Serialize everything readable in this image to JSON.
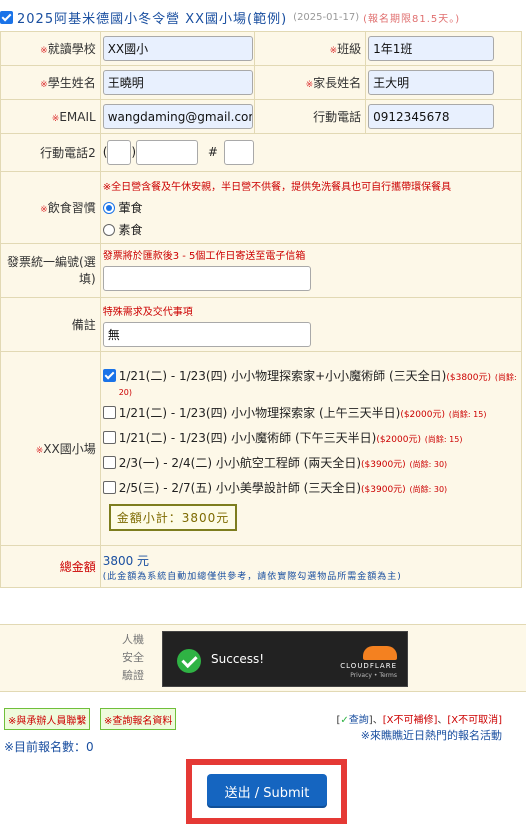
{
  "header": {
    "title": "2025阿基米德國小冬令營 XX國小場(範例)",
    "date": "(2025-01-17)",
    "deadline": "(報名期限81.5天。)"
  },
  "form": {
    "school": {
      "label": "就讀學校",
      "value": "XX國小"
    },
    "class": {
      "label": "班級",
      "value": "1年1班"
    },
    "student": {
      "label": "學生姓名",
      "value": "王曉明"
    },
    "parent": {
      "label": "家長姓名",
      "value": "王大明"
    },
    "email": {
      "label": "EMAIL",
      "value": "wangdaming@gmail.com"
    },
    "mobile": {
      "label": "行動電話",
      "value": "0912345678"
    },
    "mobile2": {
      "label": "行動電話2",
      "open_paren": "(",
      "close_paren": ")",
      "hash": "#"
    },
    "diet": {
      "label": "飲食習慣",
      "note": "※全日營含餐及午休安親，半日營不供餐，提供免洗餐具也可自行攜帶環保餐具",
      "options": [
        "葷食",
        "素食"
      ],
      "selected": "葷食"
    },
    "invoice": {
      "label": "發票統一編號(選填)",
      "note": "發票將於匯款後3 - 5個工作日寄送至電子信箱",
      "value": ""
    },
    "remark": {
      "label": "備註",
      "note": "特殊需求及交代事項",
      "value": "無"
    },
    "session": {
      "label": "XX國小場",
      "items": [
        {
          "checked": true,
          "dates": "1/21(二) - 1/23(四)",
          "course": "小小物理探索家+小小魔術師 (三天全日)",
          "price": "($3800元)",
          "remain": "(尚餘: 20)"
        },
        {
          "checked": false,
          "dates": "1/21(二) - 1/23(四)",
          "course": "小小物理探索家 (上午三天半日)",
          "price": "($2000元)",
          "remain": "(尚餘: 15)"
        },
        {
          "checked": false,
          "dates": "1/21(二) - 1/23(四)",
          "course": "小小魔術師 (下午三天半日)",
          "price": "($2000元)",
          "remain": "(尚餘: 15)"
        },
        {
          "checked": false,
          "dates": "2/3(一) - 2/4(二)",
          "course": "小小航空工程師 (兩天全日)",
          "price": "($3900元)",
          "remain": "(尚餘: 30)"
        },
        {
          "checked": false,
          "dates": "2/5(三) - 2/7(五)",
          "course": "小小美學設計師 (三天全日)",
          "price": "($3900元)",
          "remain": "(尚餘: 30)"
        }
      ],
      "subtotal": "金額小計：3800元"
    },
    "total": {
      "label": "總金額",
      "value": "3800 元",
      "note": "(此金額為系統自動加總僅供參考，請依實際勾選物品所需金額為主)"
    }
  },
  "captcha": {
    "label_lines": [
      "人機",
      "安全",
      "驗證"
    ],
    "status": "Success!",
    "brand": "CLOUDFLARE",
    "privacy": "Privacy",
    "sep": "•",
    "terms": "Terms"
  },
  "footer": {
    "contact_btn": "※與承辦人員聯繫",
    "query_btn": "※查詢報名資料",
    "legend_query": "查詢",
    "legend_nocorrect": "[X不可補修]",
    "legend_nocancel": "[X不可取消]",
    "legend_sep": "、",
    "hot_link": "※來瞧瞧近日熱門的報名活動",
    "count": "※目前報名數：0",
    "submit": "送出 / Submit"
  }
}
